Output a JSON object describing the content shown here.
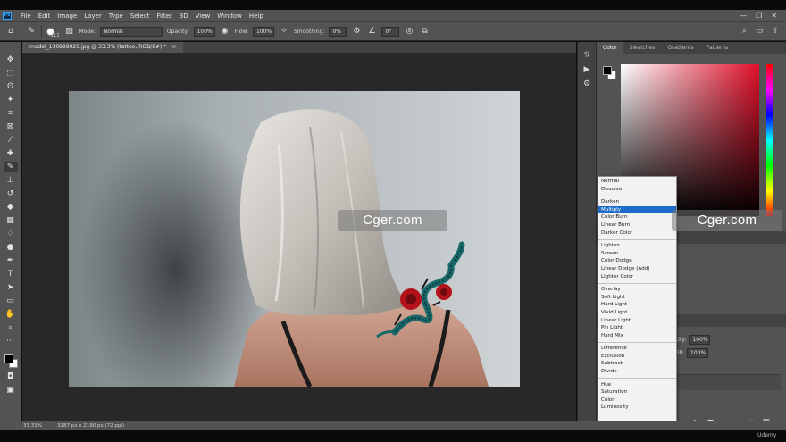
{
  "app": {
    "logo": "Ps"
  },
  "menu": {
    "items": [
      "File",
      "Edit",
      "Image",
      "Layer",
      "Type",
      "Select",
      "Filter",
      "3D",
      "View",
      "Window",
      "Help"
    ],
    "win_controls": [
      "—",
      "❐",
      "✕"
    ]
  },
  "options_bar": {
    "brush_size": "112",
    "mode_label": "Mode:",
    "mode_value": "Normal",
    "opacity_label": "Opacity:",
    "opacity_value": "100%",
    "flow_label": "Flow:",
    "flow_value": "100%",
    "smoothing_label": "Smoothing:",
    "smoothing_value": "0%",
    "angle_value": "0°"
  },
  "document": {
    "tab_title": "model_130899020.jpg @ 33.3% (tattoo, RGB/8#) *",
    "tab_close": "×"
  },
  "status": {
    "zoom": "33.33%",
    "doc_info": "3287 px x 2190 px (72 ppi)"
  },
  "panels": {
    "tabs": [
      "Color",
      "Swatches",
      "Gradients",
      "Patterns"
    ]
  },
  "layers_panel": {
    "opacity_label": "city:",
    "opacity_value": "100%",
    "fill_label": "Fill:",
    "fill_value": "100%"
  },
  "blend_modes": {
    "groups": [
      [
        "Normal",
        "Dissolve"
      ],
      [
        "Darken",
        "Multiply",
        "Color Burn",
        "Linear Burn",
        "Darker Color"
      ],
      [
        "Lighten",
        "Screen",
        "Color Dodge",
        "Linear Dodge (Add)",
        "Lighter Color"
      ],
      [
        "Overlay",
        "Soft Light",
        "Hard Light",
        "Vivid Light",
        "Linear Light",
        "Pin Light",
        "Hard Mix"
      ],
      [
        "Difference",
        "Exclusion",
        "Subtract",
        "Divide"
      ],
      [
        "Hue",
        "Saturation",
        "Color",
        "Luminosity"
      ]
    ],
    "selected": "Multiply"
  },
  "watermarks": [
    "Cger.com",
    "Cger.com"
  ],
  "footer_brand": "Udemy",
  "colors": {
    "foreground": "#000000",
    "background": "#ffffff",
    "selection": "#1c6bc9"
  }
}
